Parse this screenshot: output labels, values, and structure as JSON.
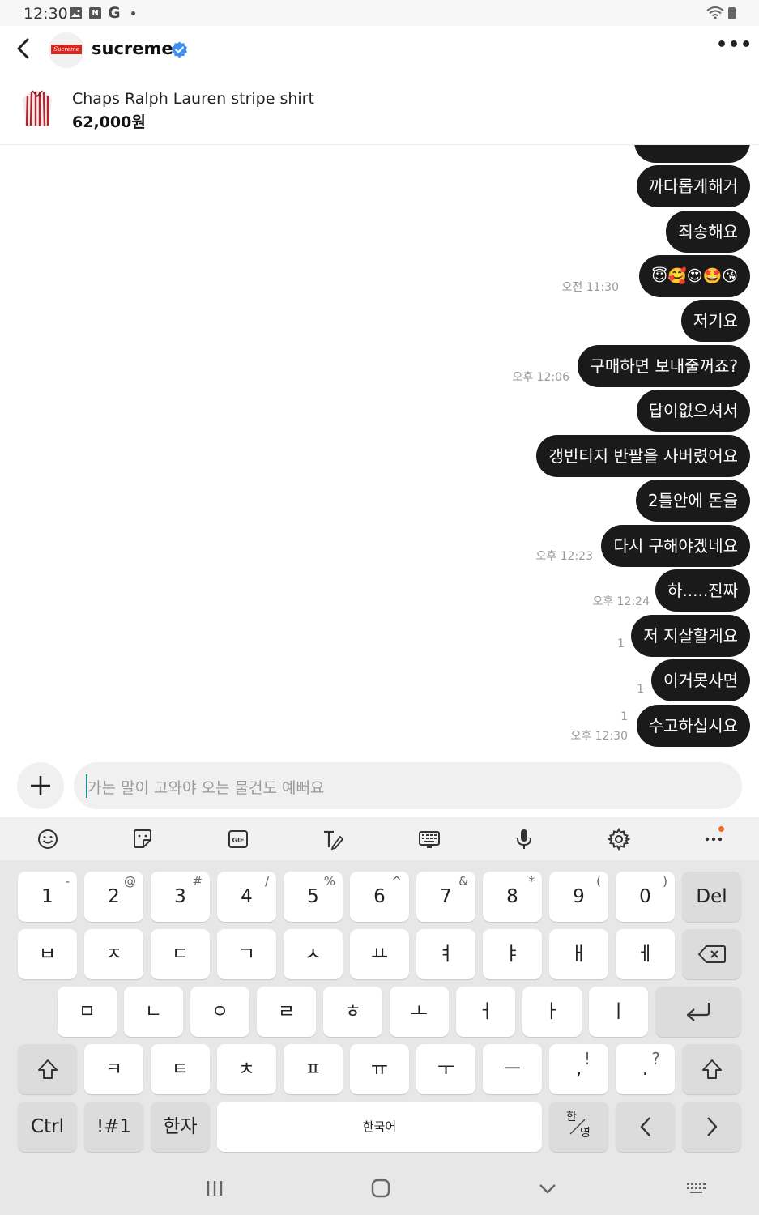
{
  "status_bar": {
    "time": "12:30",
    "notif_icon_n": "N",
    "notif_icon_g": "G"
  },
  "header": {
    "seller_name": "sucreme",
    "avatar_logo_text": "Sucreme",
    "verified_icon": "verified-badge-icon",
    "more_label": "•••"
  },
  "product": {
    "name": "Chaps Ralph Lauren stripe shirt",
    "price": "62,000원"
  },
  "messages": [
    {
      "text": "까다롭게해거"
    },
    {
      "text": "죄송해요"
    },
    {
      "text": "😇🥰😍🤩😘",
      "time": "오전 11:30"
    },
    {
      "text": "저기요"
    },
    {
      "text": "구매하면 보내줄꺼죠?",
      "time": "오후 12:06"
    },
    {
      "text": "답이없으셔서"
    },
    {
      "text": "갱빈티지 반팔을 사버렸어요"
    },
    {
      "text": "2틀안에 돈을"
    },
    {
      "text": "다시 구해야겠네요",
      "time": "오후 12:23"
    },
    {
      "text": "하.....진짜",
      "time": "오후 12:24"
    },
    {
      "text": "저 지살할게요",
      "unread": "1"
    },
    {
      "text": "이거못사면",
      "unread": "1"
    },
    {
      "text": "수고하십시요",
      "unread": "1",
      "time": "오후 12:30"
    }
  ],
  "input": {
    "placeholder": "가는 말이 고와야 오는 물건도 예뻐요",
    "value": ""
  },
  "keyboard": {
    "toolbar_icons": [
      "emoji-icon",
      "sticker-icon",
      "gif-icon",
      "handwriting-icon",
      "keyboard-layout-icon",
      "mic-icon",
      "settings-icon",
      "more-icon"
    ],
    "gif_label": "GIF",
    "row1": [
      {
        "main": "1",
        "sub": "-"
      },
      {
        "main": "2",
        "sub": "@"
      },
      {
        "main": "3",
        "sub": "#"
      },
      {
        "main": "4",
        "sub": "/"
      },
      {
        "main": "5",
        "sub": "%"
      },
      {
        "main": "6",
        "sub": "^"
      },
      {
        "main": "7",
        "sub": "&"
      },
      {
        "main": "8",
        "sub": "*"
      },
      {
        "main": "9",
        "sub": "("
      },
      {
        "main": "0",
        "sub": ")"
      }
    ],
    "del_label": "Del",
    "row2": [
      "ㅂ",
      "ㅈ",
      "ㄷ",
      "ㄱ",
      "ㅅ",
      "ㅛ",
      "ㅕ",
      "ㅑ",
      "ㅐ",
      "ㅔ"
    ],
    "row3": [
      "ㅁ",
      "ㄴ",
      "ㅇ",
      "ㄹ",
      "ㅎ",
      "ㅗ",
      "ㅓ",
      "ㅏ",
      "ㅣ"
    ],
    "row4": [
      "ㅋ",
      "ㅌ",
      "ㅊ",
      "ㅍ",
      "ㅠ",
      "ㅜ",
      "ㅡ"
    ],
    "comma": {
      "main": ",",
      "sub": "!"
    },
    "period": {
      "main": ".",
      "sub": "?"
    },
    "ctrl_label": "Ctrl",
    "symbols_label": "!#1",
    "hanja_label": "한자",
    "space_label": "한국어",
    "lang_toggle_top": "한",
    "lang_toggle_bottom": "영"
  },
  "colors": {
    "bubble": "#1a1a1a",
    "accent_cursor": "#1a8f8c",
    "verified": "#3d8ef0",
    "notification_dot": "#f26822"
  }
}
